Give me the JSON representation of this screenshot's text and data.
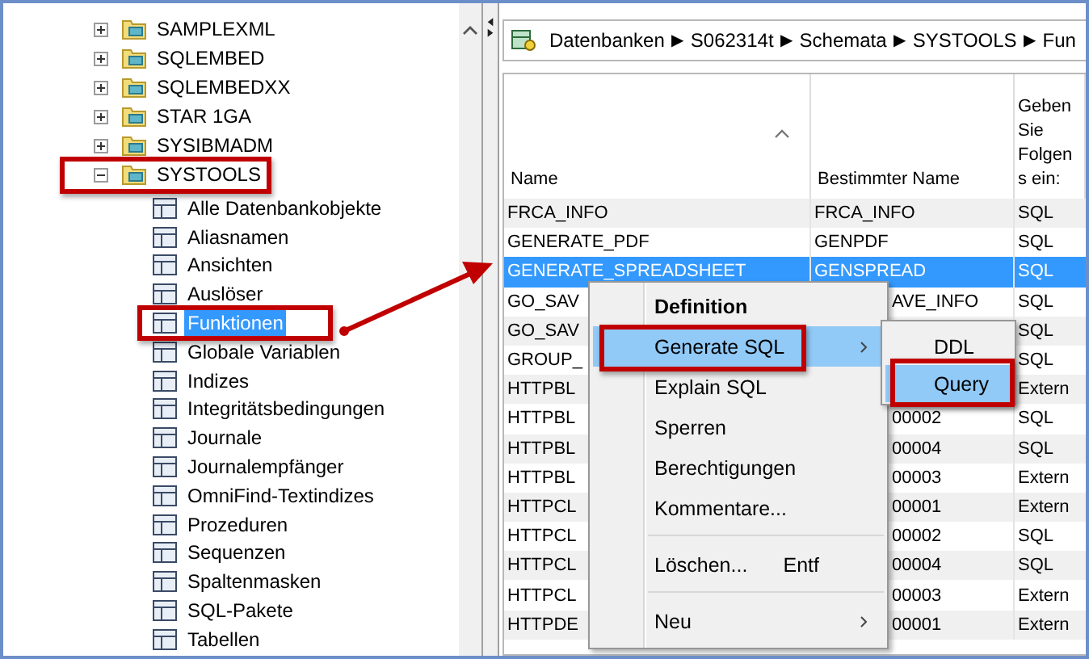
{
  "tree": {
    "items": [
      {
        "label": "SAMPLEXML",
        "expanded": false
      },
      {
        "label": "SQLEMBED",
        "expanded": false
      },
      {
        "label": "SQLEMBEDXX",
        "expanded": false
      },
      {
        "label": "STAR 1GA",
        "expanded": false
      },
      {
        "label": "SYSIBMADM",
        "expanded": false
      },
      {
        "label": "SYSTOOLS",
        "expanded": true,
        "children": [
          {
            "label": "Alle Datenbankobjekte",
            "selected": false
          },
          {
            "label": "Aliasnamen",
            "selected": false
          },
          {
            "label": "Ansichten",
            "selected": false
          },
          {
            "label": "Auslöser",
            "selected": false
          },
          {
            "label": "Funktionen",
            "selected": true
          },
          {
            "label": "Globale Variablen",
            "selected": false
          },
          {
            "label": "Indizes",
            "selected": false
          },
          {
            "label": "Integritätsbedingungen",
            "selected": false
          },
          {
            "label": "Journale",
            "selected": false
          },
          {
            "label": "Journalempfänger",
            "selected": false
          },
          {
            "label": "OmniFind-Textindizes",
            "selected": false
          },
          {
            "label": "Prozeduren",
            "selected": false
          },
          {
            "label": "Sequenzen",
            "selected": false
          },
          {
            "label": "Spaltenmasken",
            "selected": false
          },
          {
            "label": "SQL-Pakete",
            "selected": false
          },
          {
            "label": "Tabellen",
            "selected": false
          }
        ]
      }
    ]
  },
  "breadcrumb": {
    "separator": "▶",
    "items": [
      "Datenbanken",
      "S062314t",
      "Schemata",
      "SYSTOOLS",
      "Fun"
    ]
  },
  "table": {
    "columns": [
      {
        "lines": [
          "Name"
        ],
        "sorted": true
      },
      {
        "lines": [
          "Bestimmter Name"
        ],
        "sorted": false
      },
      {
        "lines": [
          "Geben",
          "Sie",
          "Folgen",
          "s ein:"
        ],
        "sorted": false
      }
    ],
    "rows": [
      {
        "name": "FRCA_INFO",
        "specific_name": "FRCA_INFO",
        "column_3": "SQL",
        "selected": false
      },
      {
        "name": "GENERATE_PDF",
        "specific_name": "GENPDF",
        "column_3": "SQL",
        "selected": false
      },
      {
        "name": "GENERATE_SPREADSHEET",
        "specific_name": "GENSPREAD",
        "column_3": "SQL",
        "selected": true
      },
      {
        "name": "GO_SAV",
        "specific_name": "AVE_INFO",
        "column_3": "SQL",
        "selected": false
      },
      {
        "name": "GO_SAV",
        "column_3": "SQL",
        "selected": false
      },
      {
        "name": "GROUP_",
        "column_3": "SQL",
        "selected": false
      },
      {
        "name": "HTTPBL",
        "column_3": "Extern",
        "selected": false
      },
      {
        "name": "HTTPBL",
        "specific_name": "00002",
        "column_3": "SQL",
        "selected": false
      },
      {
        "name": "HTTPBL",
        "specific_name": "00004",
        "column_3": "SQL",
        "selected": false
      },
      {
        "name": "HTTPBL",
        "specific_name": "00003",
        "column_3": "Extern",
        "selected": false
      },
      {
        "name": "HTTPCL",
        "specific_name": "00001",
        "column_3": "Extern",
        "selected": false
      },
      {
        "name": "HTTPCL",
        "specific_name": "00002",
        "column_3": "SQL",
        "selected": false
      },
      {
        "name": "HTTPCL",
        "specific_name": "00004",
        "column_3": "SQL",
        "selected": false
      },
      {
        "name": "HTTPCL",
        "specific_name": "00003",
        "column_3": "Extern",
        "selected": false
      },
      {
        "name": "HTTPDE",
        "specific_name": "00001",
        "column_3": "Extern",
        "selected": false
      }
    ]
  },
  "context_menu": {
    "items": [
      {
        "kind": "item",
        "label": "Definition",
        "bold": true,
        "selected": false,
        "has_submenu": false
      },
      {
        "kind": "item",
        "label": "Generate SQL",
        "bold": false,
        "selected": true,
        "has_submenu": true
      },
      {
        "kind": "item",
        "label": "Explain SQL",
        "bold": false,
        "selected": false,
        "has_submenu": false
      },
      {
        "kind": "item",
        "label": "Sperren",
        "bold": false,
        "selected": false,
        "has_submenu": false
      },
      {
        "kind": "item",
        "label": "Berechtigungen",
        "bold": false,
        "selected": false,
        "has_submenu": false
      },
      {
        "kind": "item",
        "label": "Kommentare...",
        "bold": false,
        "selected": false,
        "has_submenu": false
      },
      {
        "kind": "separator"
      },
      {
        "kind": "item",
        "label": "Löschen...",
        "shortcut": "Entf",
        "bold": false,
        "selected": false,
        "has_submenu": false
      },
      {
        "kind": "separator"
      },
      {
        "kind": "item",
        "label": "Neu",
        "bold": false,
        "selected": false,
        "has_submenu": true
      }
    ]
  },
  "submenu": {
    "items": [
      {
        "label": "DDL",
        "selected": false
      },
      {
        "label": "Query",
        "selected": true
      }
    ]
  }
}
